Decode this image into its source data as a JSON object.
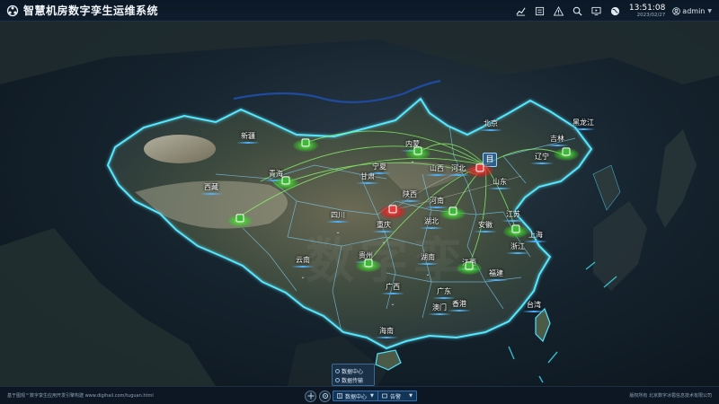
{
  "app": {
    "title": "智慧机房数字孪生运维系统"
  },
  "header": {
    "time": "13:51:08",
    "date": "2023/02/27",
    "user": "admin",
    "icons": [
      "chart-icon",
      "list-icon",
      "warning-icon",
      "search-icon",
      "monitor-icon",
      "globe-icon",
      "user-icon"
    ]
  },
  "map": {
    "provinces": [
      {
        "name": "新疆"
      },
      {
        "name": "西藏"
      },
      {
        "name": "青海"
      },
      {
        "name": "甘肃"
      },
      {
        "name": "宁夏"
      },
      {
        "name": "内蒙"
      },
      {
        "name": "北京"
      },
      {
        "name": "黑龙江"
      },
      {
        "name": "吉林"
      },
      {
        "name": "辽宁"
      },
      {
        "name": "山西"
      },
      {
        "name": "河北"
      },
      {
        "name": "山东"
      },
      {
        "name": "陕西"
      },
      {
        "name": "河南"
      },
      {
        "name": "四川"
      },
      {
        "name": "重庆"
      },
      {
        "name": "湖北"
      },
      {
        "name": "安徽"
      },
      {
        "name": "江苏"
      },
      {
        "name": "上海"
      },
      {
        "name": "浙江"
      },
      {
        "name": "云南"
      },
      {
        "name": "贵州"
      },
      {
        "name": "湖南"
      },
      {
        "name": "江西"
      },
      {
        "name": "福建"
      },
      {
        "name": "广西"
      },
      {
        "name": "广东"
      },
      {
        "name": "台湾"
      },
      {
        "name": "香港"
      },
      {
        "name": "澳门"
      },
      {
        "name": "海南"
      }
    ],
    "watermark": "数字孪"
  },
  "footer": {
    "left": "基于图观™数字孪生应用开发引擎构建 www.digihail.com/tuguan.html",
    "right": "版权所有 北京数字冰雹信息技术有限公司",
    "view_select": "数据中心",
    "alarm_select": "告警",
    "dropdown": [
      "数据中心",
      "数据传输"
    ]
  },
  "colors": {
    "accent": "#2f6fb0",
    "normal": "#3fb83a",
    "alarm": "#e23b3b",
    "border_glow": "#4fe3ff"
  }
}
